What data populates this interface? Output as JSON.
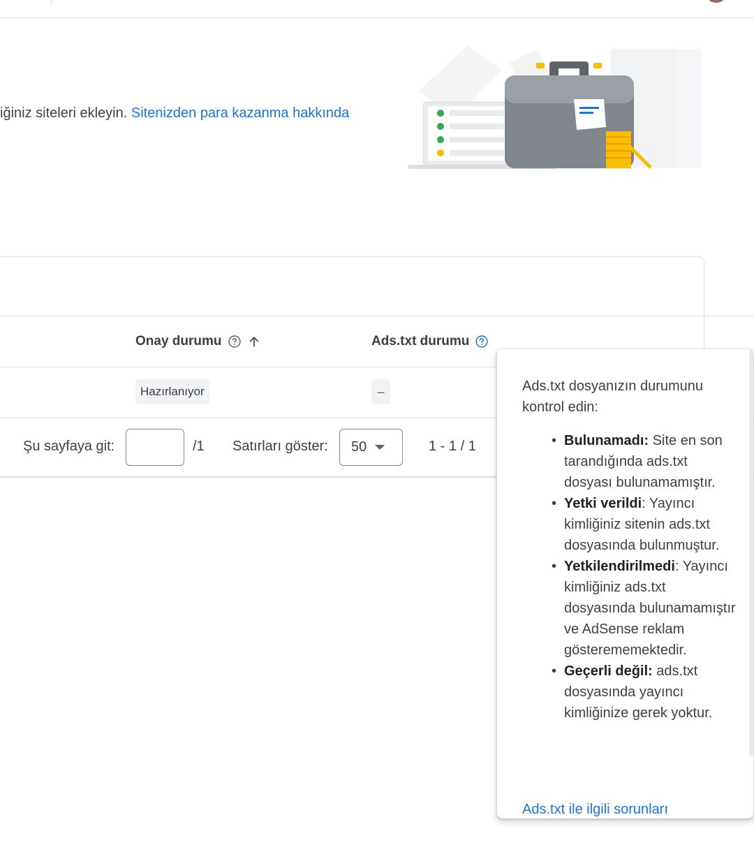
{
  "intro": {
    "text": "iğiniz siteleri ekleyin.",
    "link": "Sitenizden para kazanma hakkında"
  },
  "table": {
    "columns": {
      "approval": "Onay durumu",
      "adstxt": "Ads.txt durumu"
    },
    "rows": [
      {
        "approval": "Hazırlanıyor",
        "adstxt": "–"
      }
    ]
  },
  "pagination": {
    "goto_label": "Şu sayfaya git:",
    "page_input_value": "",
    "page_total": "/1",
    "rows_label": "Satırları göster:",
    "rows_value": "50",
    "range": "1 - 1 / 1"
  },
  "tooltip": {
    "intro": "Ads.txt dosyanızın durumunu kontrol edin:",
    "items": [
      {
        "term": "Bulunamadı:",
        "desc": " Site en son tarandığında ads.txt dosyası bulunamamıştır."
      },
      {
        "term": "Yetki verildi",
        "desc": ": Yayıncı kimliğiniz sitenin ads.txt dosyasında bulunmuştur."
      },
      {
        "term": "Yetkilendirilmedi",
        "desc": ": Yayıncı kimliğiniz ads.txt dosyasında bulunamamıştır ve AdSense reklam gösterememektedir."
      },
      {
        "term": "Geçerli değil:",
        "desc": " ads.txt dosyasında yayıncı kimliğinize gerek yoktur."
      }
    ],
    "link": "Ads.txt ile ilgili sorunları"
  },
  "colors": {
    "link": "#1a73e8",
    "text": "#3c4043",
    "chip_bg": "#f1f3f4",
    "border": "#e0e0e0"
  },
  "icons": {
    "approval_help": "help-circle-icon",
    "sort": "arrow-up-icon",
    "adstxt_help": "help-circle-icon",
    "rows_dropdown": "caret-down-icon"
  }
}
